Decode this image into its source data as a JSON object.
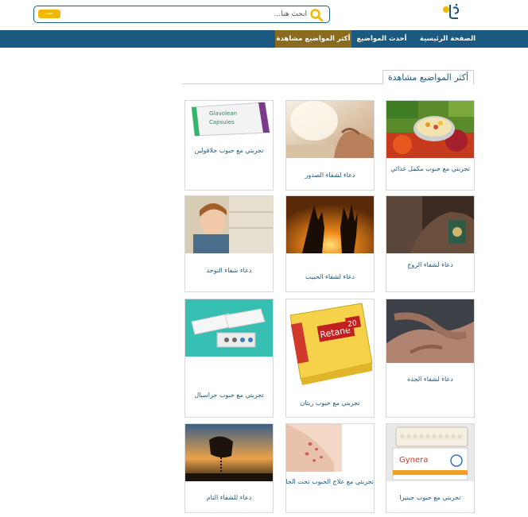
{
  "header": {
    "search_placeholder": "ابحث هنا...",
    "search_button": "بحث",
    "logo_icon": "site-logo-icon"
  },
  "nav": {
    "items": [
      {
        "label": "الصفحة الرئيسية"
      },
      {
        "label": "أحدث المواضيع"
      },
      {
        "label": "أكثر المواضيع مشاهدة",
        "active": true
      }
    ]
  },
  "section": {
    "title": "أكثر المواضيع مشاهدة"
  },
  "colors": {
    "nav_bg": "#1b5a80",
    "nav_active": "#8a6a1c",
    "accent_yellow": "#f4b700",
    "link_blue": "#1b5a80"
  },
  "articles": [
    {
      "title": "تجربتي مع حبوب مكمل غذائي",
      "image": "vegetables-supplements-image"
    },
    {
      "title": "دعاء لشفاء الصدور",
      "image": "praying-hands-image"
    },
    {
      "title": "تجربتي مع حبوب جلافولين",
      "image": "glavolean-capsules-box-image"
    },
    {
      "title": "دعاء لشفاء الزوج",
      "image": "holding-quran-image"
    },
    {
      "title": "دعاء لشفاء الحبيب",
      "image": "sunset-hands-image"
    },
    {
      "title": "دعاء شفاء التوحد",
      "image": "sad-child-window-image"
    },
    {
      "title": "دعاء لشفاء الجدة",
      "image": "elderly-hands-image"
    },
    {
      "title": "تجربتي مع حبوب ريتان",
      "image": "retane-box-image"
    },
    {
      "title": "تجربتي مع حبوب جراسيال",
      "image": "gracial-pills-image"
    },
    {
      "title": "تجربتي مع حبوب جينيرا",
      "image": "gynera-pills-image"
    },
    {
      "title": "تجربتي مع علاج الحبوب تحت الجلد",
      "image": "skin-acne-image"
    },
    {
      "title": "دعاء للشفاء التام",
      "image": "prayer-beads-sunset-image"
    }
  ]
}
